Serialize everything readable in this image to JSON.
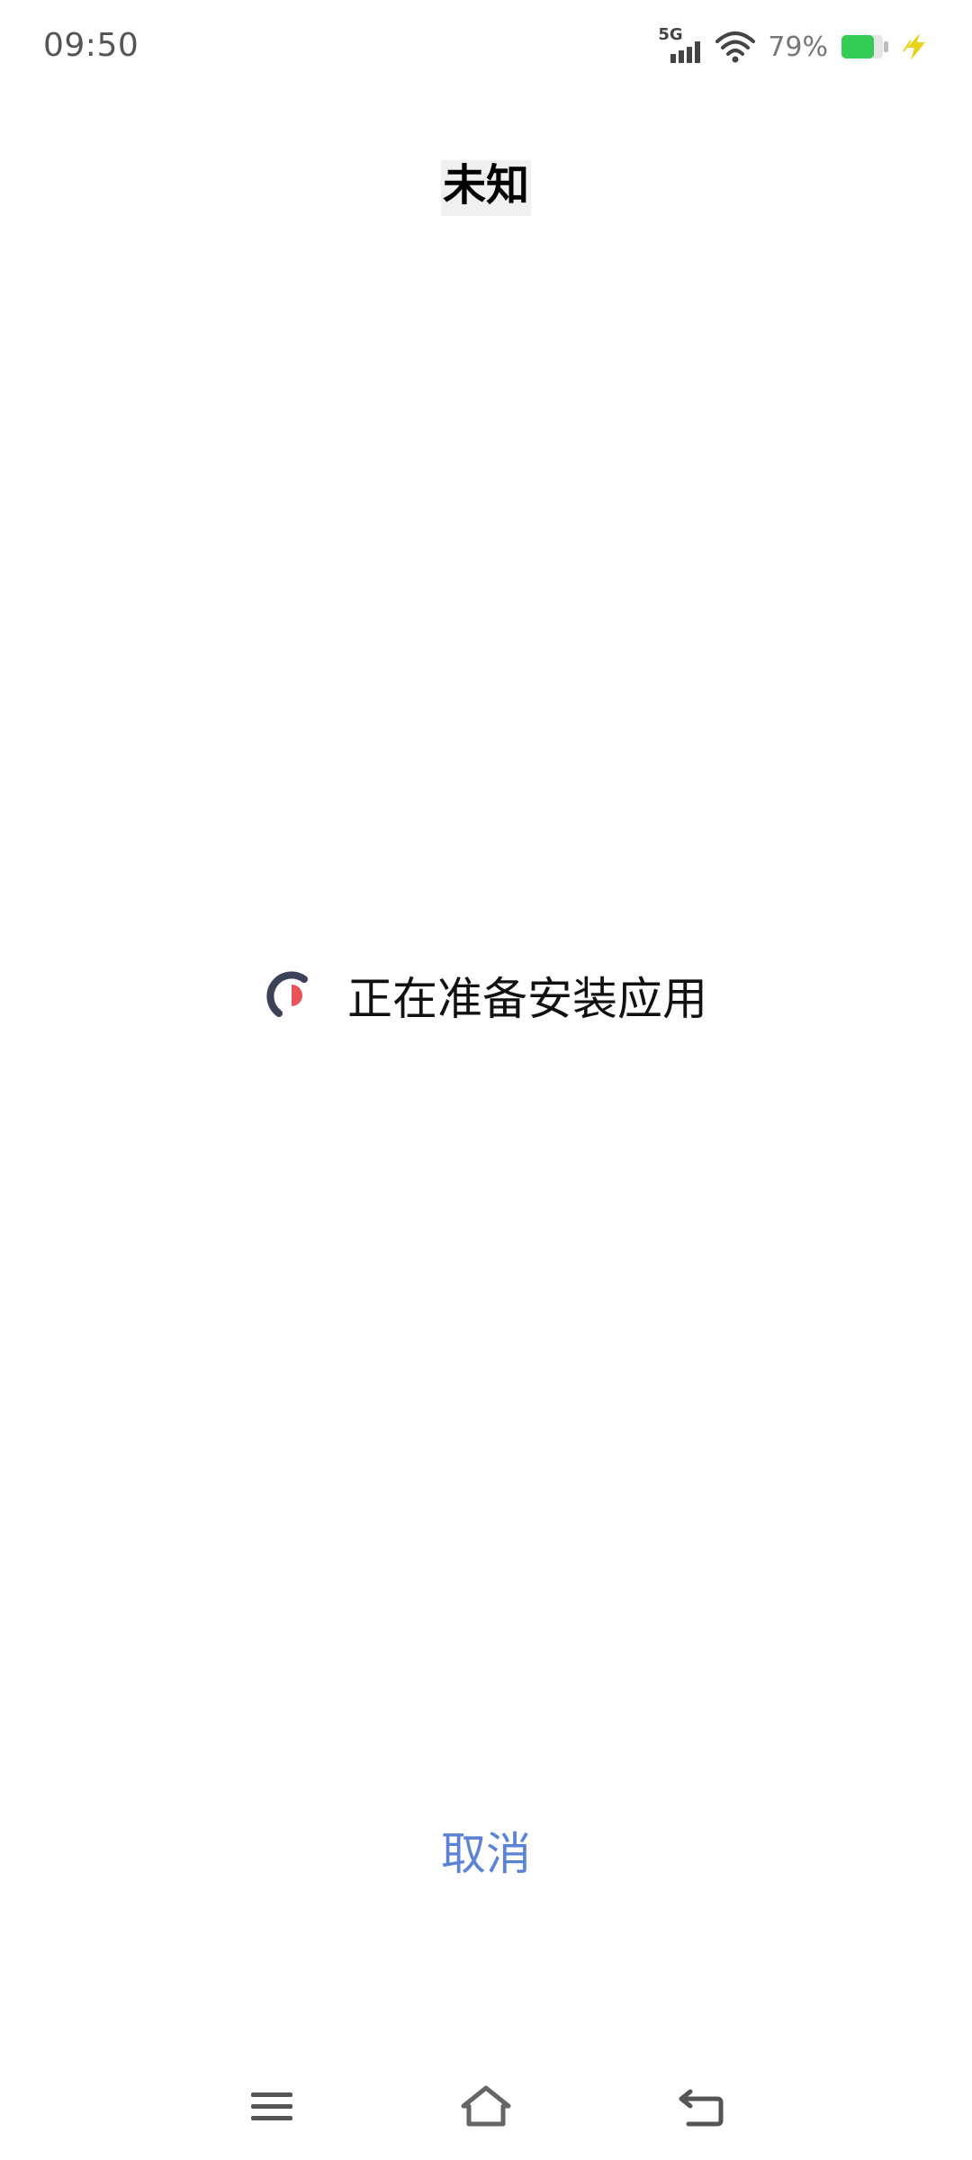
{
  "status_bar": {
    "time": "09:50",
    "network": "5G",
    "battery_percent": "79%",
    "battery_level": 0.79,
    "battery_color": "#33cc55",
    "charging_color": "#e8d21a"
  },
  "dialog": {
    "title": "未知",
    "message": "正在准备安装应用",
    "cancel_label": "取消",
    "accent_color": "#5b82d6"
  },
  "nav_bar": {
    "icons": [
      "menu-icon",
      "home-icon",
      "back-icon"
    ]
  }
}
